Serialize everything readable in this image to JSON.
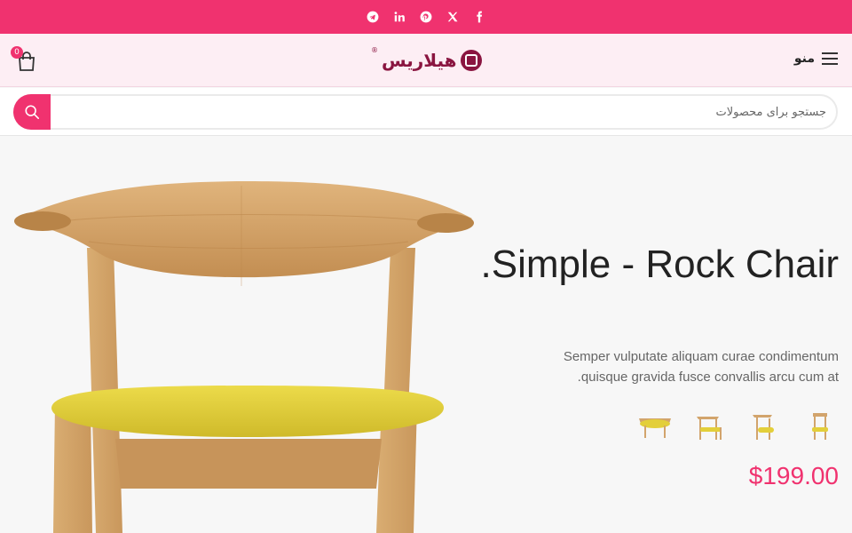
{
  "topbar": {
    "social": [
      "facebook-icon",
      "x-icon",
      "pinterest-icon",
      "linkedin-icon",
      "telegram-icon"
    ],
    "color": "#f0326f"
  },
  "header": {
    "menu_label": "منو",
    "logo_text": "هیلاریس",
    "logo_reg": "®",
    "cart_count": "0"
  },
  "search": {
    "placeholder": "جستجو برای محصولات"
  },
  "hero": {
    "title": "Simple - Rock Chair.",
    "description": "Semper vulputate aliquam curae condimentum quisque gravida fusce convallis arcu cum at.",
    "price": "$199.00"
  },
  "colors": {
    "accent": "#f0326f",
    "brand": "#8a1540",
    "seat": "#e3cf3a",
    "wood": "#d2a46c"
  }
}
